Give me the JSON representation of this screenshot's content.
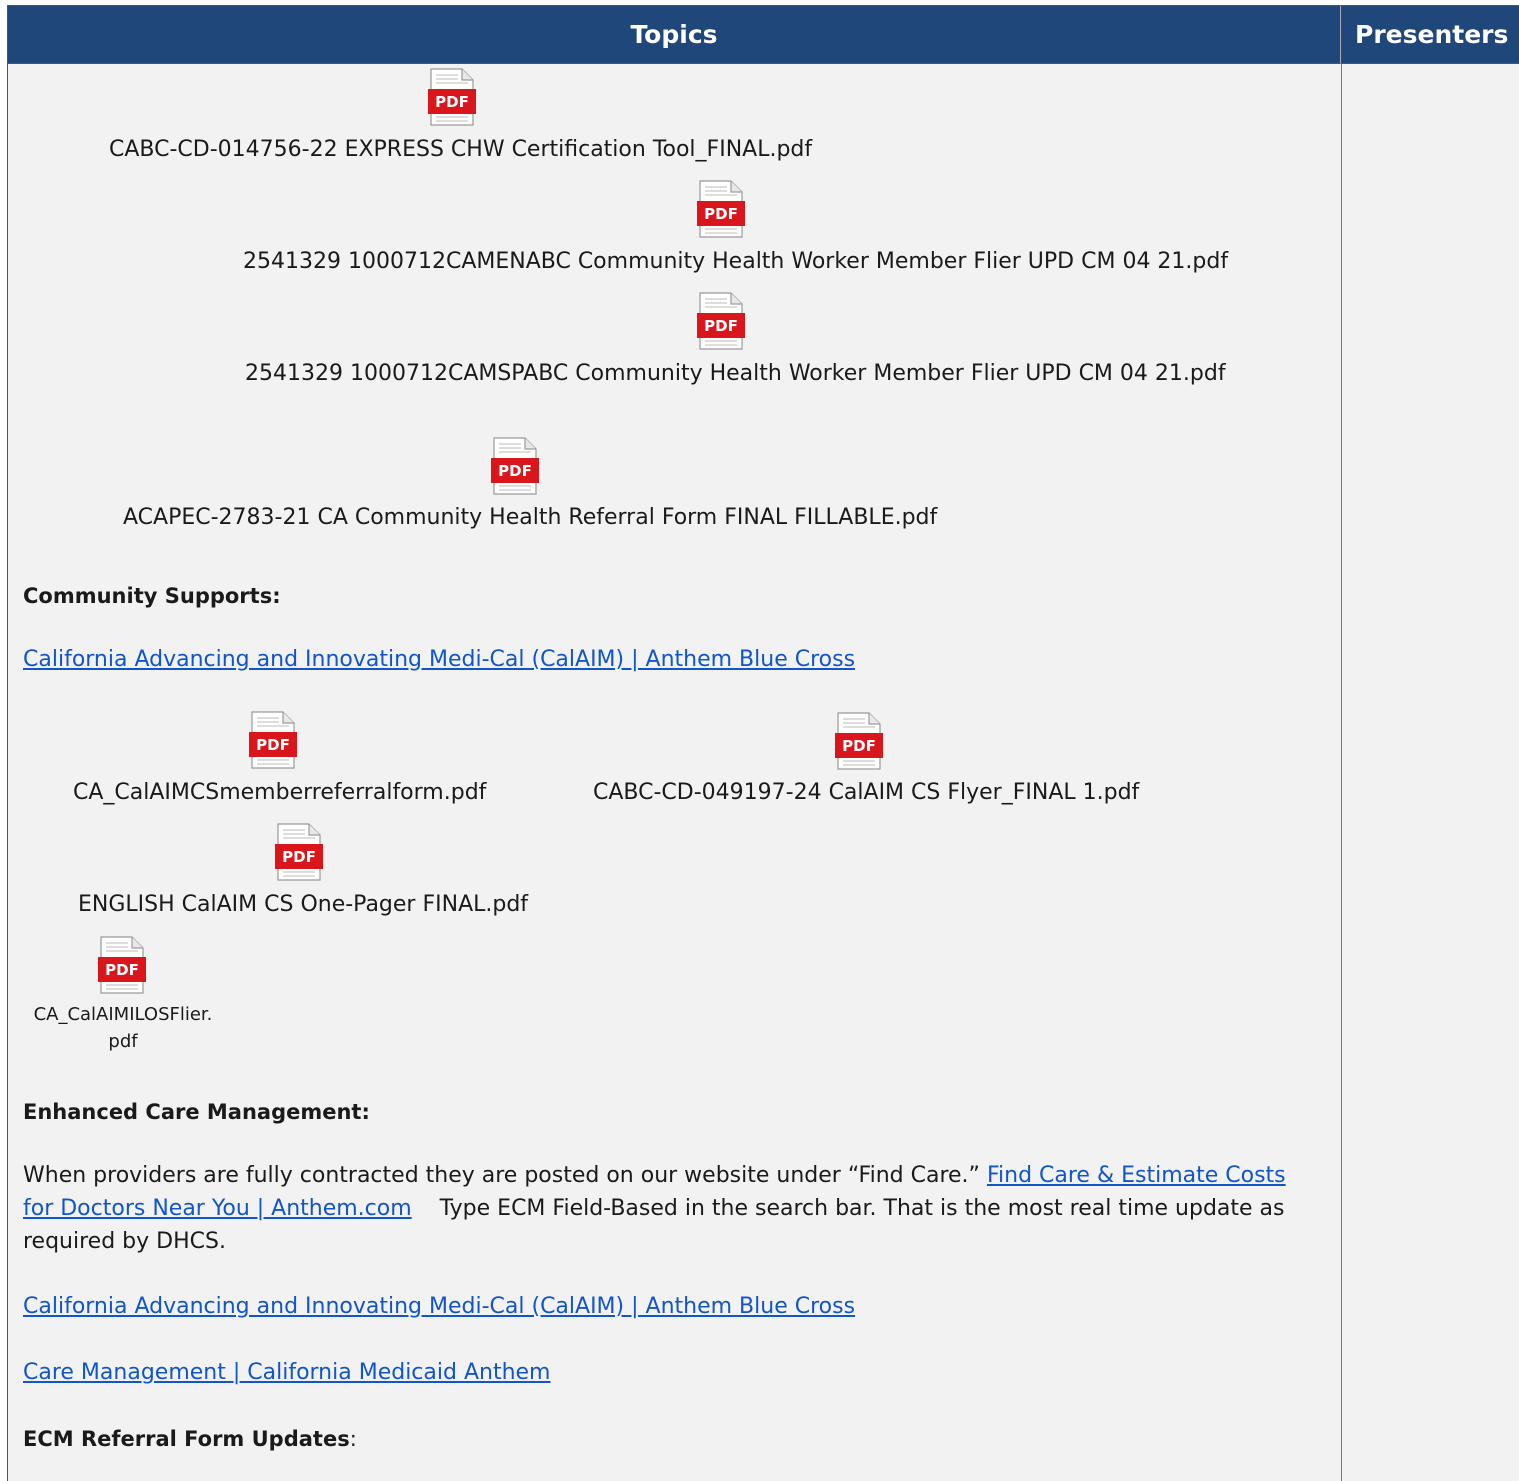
{
  "header": {
    "topics": "Topics",
    "presenters": "Presenters"
  },
  "files": [
    {
      "name": "CABC-CD-014756-22 EXPRESS CHW Certification Tool_FINAL.pdf",
      "icon": "pdf-icon"
    },
    {
      "name": "2541329 1000712CAMENABC Community Health Worker Member Flier UPD CM 04 21.pdf",
      "icon": "pdf-icon"
    },
    {
      "name": "2541329 1000712CAMSPABC Community Health Worker Member Flier UPD CM 04 21.pdf",
      "icon": "pdf-icon"
    },
    {
      "name": "ACAPEC-2783-21 CA Community Health Referral Form FINAL FILLABLE.pdf",
      "icon": "pdf-icon"
    },
    {
      "name": "CA_CalAIMCSmemberreferralform.pdf",
      "icon": "pdf-icon"
    },
    {
      "name": "CABC-CD-049197-24 CalAIM CS Flyer_FINAL 1.pdf",
      "icon": "pdf-icon"
    },
    {
      "name": "ENGLISH CalAIM CS One-Pager FINAL.pdf",
      "icon": "pdf-icon"
    },
    {
      "name": "CA_CalAIMILOSFlier.\npdf",
      "icon": "pdf-icon"
    }
  ],
  "sections": {
    "community_supports": "Community Supports:",
    "calaim_link_1": "California Advancing and Innovating Medi-Cal (CalAIM) | Anthem Blue Cross",
    "ecm_heading": "Enhanced Care Management:",
    "ecm_text_before": "When providers are fully contracted they are posted on our website under “Find Care.” ",
    "ecm_link": "Find Care & Estimate Costs for Doctors Near You | Anthem.com",
    "ecm_text_after": "    Type ECM Field-Based in the search bar. That is the most real time update as required by DHCS.",
    "calaim_link_2": "California Advancing and Innovating Medi-Cal (CalAIM) | Anthem Blue Cross",
    "care_mgmt_link": "Care Management | California Medicaid Anthem",
    "ecm_referral_heading": "ECM Referral Form Updates",
    "ecm_referral_colon": ":"
  },
  "colors": {
    "header_bg": "#1f477a",
    "cell_bg": "#f2f2f2",
    "link": "#1155cc",
    "pdf_red": "#d9161c"
  }
}
